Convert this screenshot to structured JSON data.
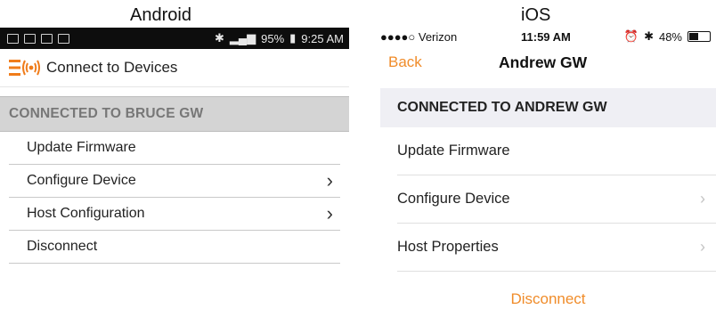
{
  "captions": {
    "android": "Android",
    "ios": "iOS"
  },
  "android": {
    "status": {
      "battery": "95%",
      "time": "9:25 AM"
    },
    "header_title": "Connect to Devices",
    "section_title": "CONNECTED TO BRUCE GW",
    "items": [
      {
        "label": "Update Firmware",
        "chevron": false
      },
      {
        "label": "Configure Device",
        "chevron": true
      },
      {
        "label": "Host Configuration",
        "chevron": true
      },
      {
        "label": "Disconnect",
        "chevron": false
      }
    ],
    "accent": "#f07c1a"
  },
  "ios": {
    "status": {
      "carrier": "●●●●○ Verizon",
      "time": "11:59 AM",
      "battery": "48%"
    },
    "back_label": "Back",
    "nav_title": "Andrew GW",
    "section_title": "CONNECTED TO ANDREW GW",
    "items": [
      {
        "label": "Update Firmware",
        "chevron": false
      },
      {
        "label": "Configure Device",
        "chevron": true
      },
      {
        "label": "Host Properties",
        "chevron": true
      }
    ],
    "disconnect_label": "Disconnect",
    "accent": "#f08c2a"
  }
}
